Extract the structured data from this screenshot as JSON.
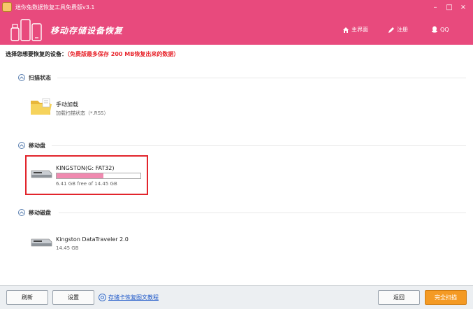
{
  "window": {
    "title": "迷你兔数据恢复工具免费版v3.1"
  },
  "header": {
    "app_name": "移动存储设备恢复",
    "links": [
      {
        "label": "主界面",
        "icon": "home-icon"
      },
      {
        "label": "注册",
        "icon": "register-icon"
      },
      {
        "label": "QQ",
        "icon": "qq-icon"
      }
    ]
  },
  "prompt": {
    "label": "选择您想要恢复的设备：",
    "hint": "（免费版最多保存 200 MB恢复出来的数据）"
  },
  "sections": {
    "scan_status": {
      "title": "扫描状态",
      "item": {
        "name": "手动加载",
        "desc": "加载扫描状态（*.RSS）"
      }
    },
    "removable_disk": {
      "title": "移动盘",
      "item": {
        "name": "KINGSTON(G: FAT32)",
        "desc": "6.41 GB free of 14.45 GB",
        "used_fraction": 0.556
      }
    },
    "mobile_disk": {
      "title": "移动磁盘",
      "item": {
        "name": "Kingston DataTraveler 2.0",
        "desc": "14.45 GB"
      }
    }
  },
  "footer": {
    "refresh": "刷新",
    "settings": "设置",
    "tutorial": "存储卡恢复图文教程",
    "back": "返回",
    "full_scan": "完全扫描"
  },
  "colors": {
    "brand": "#e84a7d",
    "highlight": "#e2252c",
    "progress": "#f08ab0",
    "primary_button": "#f49a24"
  }
}
